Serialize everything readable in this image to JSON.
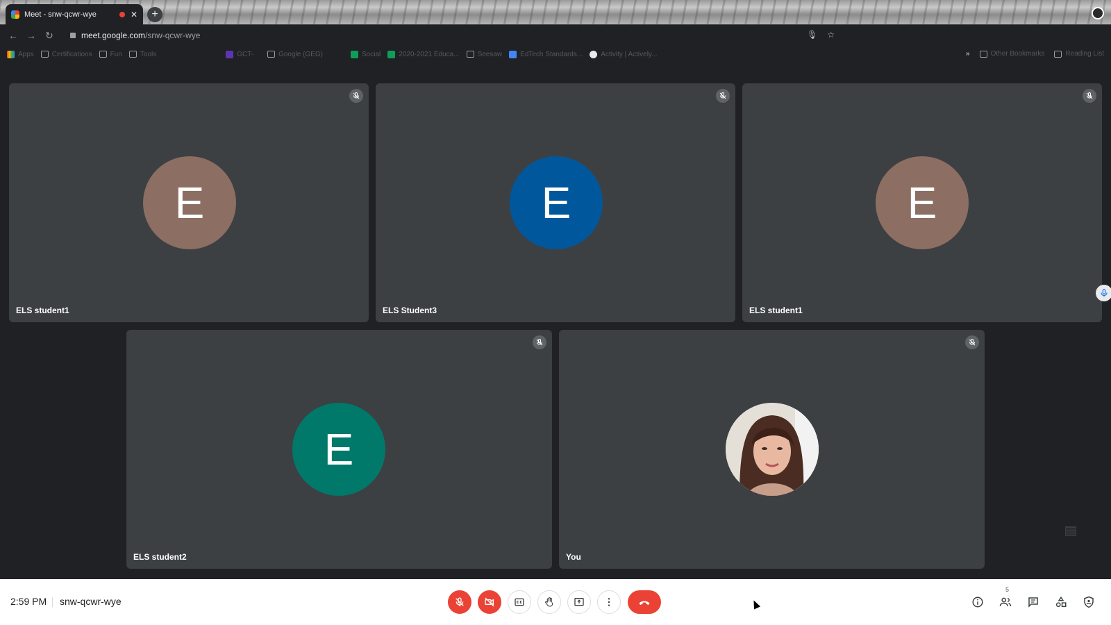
{
  "browser": {
    "tab_title": "Meet - snw-qcwr-wye",
    "new_tab": "+",
    "url_host": "meet.google.com",
    "url_path": "/snw-qcwr-wye"
  },
  "bookmarks": {
    "items": [
      "Apps",
      "Certifications",
      "Fun",
      "Tools",
      "GCT-",
      "Google (GEG)",
      "Social",
      "2020-2021 Educa...",
      "Seesaw",
      "EdTech Standards...",
      "Activity | Actively..."
    ],
    "overflow": "»",
    "other": "Other Bookmarks",
    "reading_list": "Reading List"
  },
  "participants": [
    {
      "name": "ELS student1",
      "initial": "E",
      "color": "#8d6e63"
    },
    {
      "name": "ELS Student3",
      "initial": "E",
      "color": "#01579b"
    },
    {
      "name": "ELS student1",
      "initial": "E",
      "color": "#8d6e63"
    },
    {
      "name": "ELS student2",
      "initial": "E",
      "color": "#00796b"
    },
    {
      "name": "You",
      "initial": "",
      "color": ""
    }
  ],
  "bottom": {
    "time": "2:59 PM",
    "meeting_code": "snw-qcwr-wye",
    "participant_count": "5"
  },
  "icons": {
    "mic_muted": "mic-off-icon",
    "camera_off": "videocam-off-icon",
    "captions": "closed-caption-icon",
    "raise_hand": "hand-icon",
    "present": "present-screen-icon",
    "more": "more-vert-icon",
    "hang_up": "call-end-icon",
    "info": "info-icon",
    "people": "people-icon",
    "chat": "chat-icon",
    "activities": "activities-icon",
    "host_controls": "shield-icon"
  },
  "colors": {
    "accent_red": "#ea4335",
    "tile_bg": "#3c4043",
    "page_bg": "#202124"
  }
}
